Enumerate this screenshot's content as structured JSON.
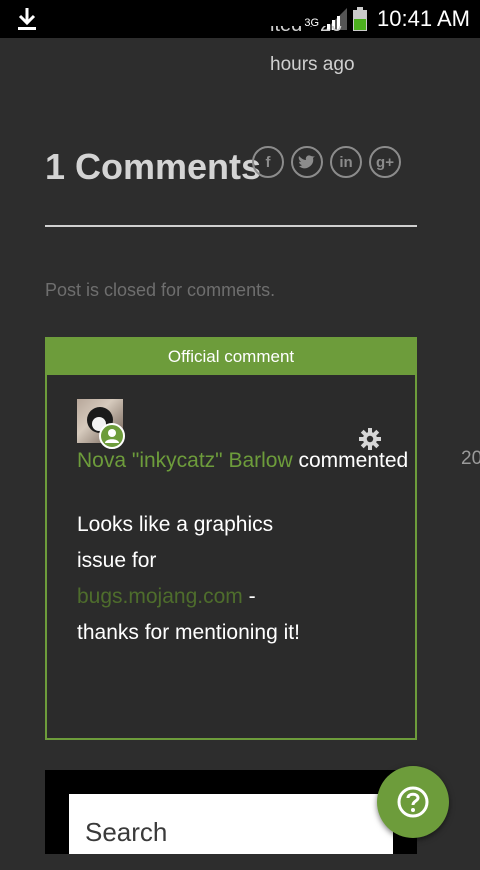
{
  "status_bar": {
    "network_label": "3G",
    "time": "10:41 AM",
    "icons": [
      "download-icon",
      "data-arrows-icon",
      "signal-icon",
      "battery-icon"
    ]
  },
  "post": {
    "cut_line": "ited · 20",
    "time_ago": "hours ago"
  },
  "comments": {
    "title": "1 Comments",
    "share": [
      {
        "icon": "facebook-icon",
        "glyph": "f"
      },
      {
        "icon": "twitter-icon",
        "glyph": "t"
      },
      {
        "icon": "linkedin-icon",
        "glyph": "in"
      },
      {
        "icon": "googleplus-icon",
        "glyph": "g+"
      }
    ],
    "closed_note": "Post is closed for comments."
  },
  "official_comment": {
    "banner": "Official comment",
    "author": "Nova \"inkycatz\" Barlow",
    "action": "commented",
    "date_cut": "20",
    "body_before_link": "Looks like a graphics issue for ",
    "link_text": "bugs.mojang.com",
    "body_after_link": " - thanks for mentioning it!"
  },
  "search": {
    "placeholder": "Search"
  },
  "colors": {
    "accent": "#6d9c3b",
    "background": "#2d2d2d"
  }
}
